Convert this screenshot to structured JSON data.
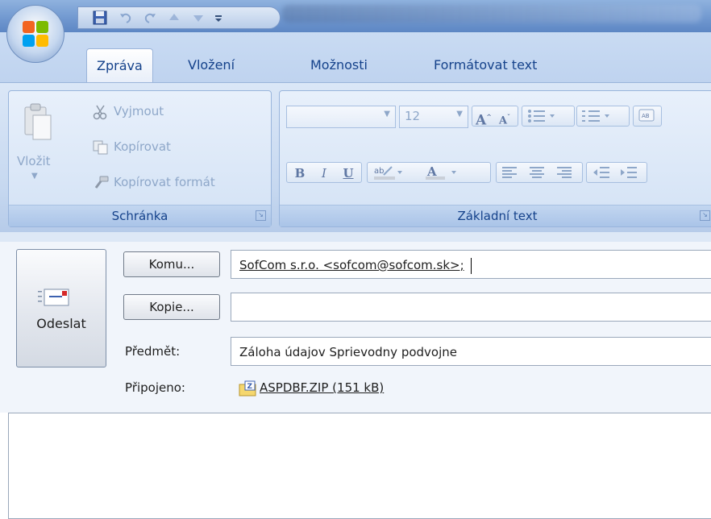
{
  "window": {
    "quick_access_icons": [
      "save-icon",
      "undo-icon",
      "redo-icon",
      "previous-item-icon",
      "next-item-icon",
      "customize-qat-icon"
    ]
  },
  "tabs": [
    "Zpráva",
    "Vložení",
    "Možnosti",
    "Formátovat text"
  ],
  "ribbon": {
    "clipboard": {
      "paste_label": "Vložit",
      "cut_label": "Vyjmout",
      "copy_label": "Kopírovat",
      "format_painter_label": "Kopírovat formát",
      "group_label": "Schránka"
    },
    "basic_text": {
      "font_name": "",
      "font_size": "12",
      "bold": "B",
      "italic": "I",
      "underline": "U",
      "group_label": "Základní text"
    }
  },
  "message": {
    "send_label": "Odeslat",
    "to_button": "Komu...",
    "cc_button": "Kopie...",
    "subject_label": "Předmět:",
    "attached_label": "Připojeno:",
    "to_value": "SofCom s.r.o. <sofcom@sofcom.sk>;",
    "cc_value": "",
    "subject_value": "Záloha údajov Sprievodny podvojne",
    "attachment": "ASPDBF.ZIP (151 kB)"
  },
  "colors": {
    "ribbon_text": "#15428b",
    "ribbon_bg": "#c6d8f0",
    "font_color_swatch": "#c00000",
    "highlight_swatch": "#ffff00"
  }
}
